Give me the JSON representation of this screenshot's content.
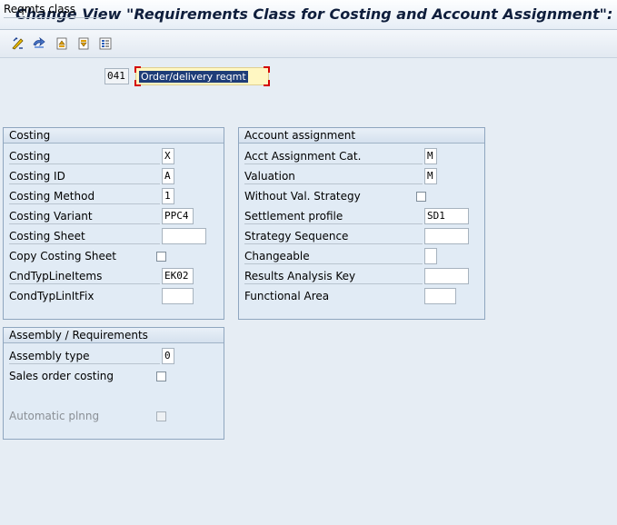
{
  "window": {
    "title": "Change View \"Requirements Class for Costing and Account Assignment\": D"
  },
  "toolbar": {
    "buttons": [
      {
        "name": "display-change-icon"
      },
      {
        "name": "other-entry-icon"
      },
      {
        "name": "previous-entry-icon"
      },
      {
        "name": "next-entry-icon"
      },
      {
        "name": "variable-list-icon"
      }
    ]
  },
  "header": {
    "label": "Reqmts class",
    "value": "041",
    "description": "Order/delivery reqmt"
  },
  "costing": {
    "title": "Costing",
    "costing_label": "Costing",
    "costing_value": "X",
    "costing_id_label": "Costing ID",
    "costing_id_value": "A",
    "costing_method_label": "Costing Method",
    "costing_method_value": "1",
    "costing_variant_label": "Costing Variant",
    "costing_variant_value": "PPC4",
    "costing_sheet_label": "Costing Sheet",
    "costing_sheet_value": "",
    "copy_costing_sheet_label": "Copy Costing Sheet",
    "copy_costing_sheet_checked": false,
    "cond_typ_line_items_label": "CndTypLineItems",
    "cond_typ_line_items_value": "EK02",
    "cond_typ_lin_it_fix_label": "CondTypLinItFix",
    "cond_typ_lin_it_fix_value": ""
  },
  "account": {
    "title": "Account assignment",
    "acct_assignment_cat_label": "Acct Assignment Cat.",
    "acct_assignment_cat_value": "M",
    "valuation_label": "Valuation",
    "valuation_value": "M",
    "without_val_strategy_label": "Without Val. Strategy",
    "without_val_strategy_checked": false,
    "settlement_profile_label": "Settlement profile",
    "settlement_profile_value": "SD1",
    "strategy_sequence_label": "Strategy Sequence",
    "strategy_sequence_value": "",
    "changeable_label": "Changeable",
    "changeable_value": "",
    "results_analysis_key_label": "Results Analysis Key",
    "results_analysis_key_value": "",
    "functional_area_label": "Functional Area",
    "functional_area_value": ""
  },
  "assembly": {
    "title": "Assembly / Requirements",
    "assembly_type_label": "Assembly type",
    "assembly_type_value": "0",
    "sales_order_costing_label": "Sales order costing",
    "sales_order_costing_checked": false,
    "automatic_plnng_label": "Automatic plnng",
    "automatic_plnng_checked": false
  }
}
